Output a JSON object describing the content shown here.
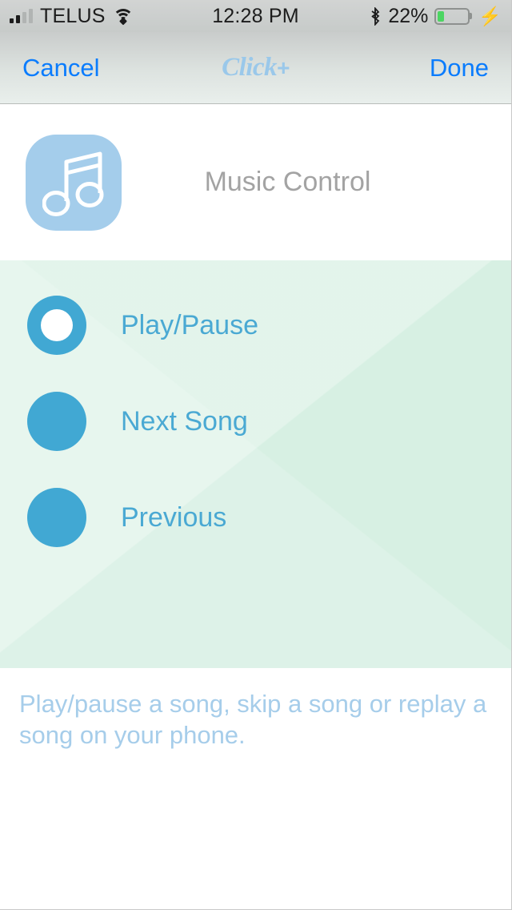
{
  "status_bar": {
    "carrier": "TELUS",
    "time": "12:28 PM",
    "battery_percent": "22%",
    "battery_level": 22,
    "signal_bars_filled": 2,
    "signal_bars_total": 4,
    "icons": {
      "signal": "signal-bars-icon",
      "wifi": "wifi-icon",
      "bluetooth": "bluetooth-icon",
      "battery": "battery-icon",
      "charging": "charging-bolt-icon"
    }
  },
  "nav_bar": {
    "cancel_label": "Cancel",
    "done_label": "Done",
    "brand": "Click",
    "brand_plus": "+"
  },
  "header": {
    "title": "Music Control",
    "icon_name": "music-note-icon"
  },
  "options": {
    "items": [
      {
        "label": "Play/Pause",
        "selected": true
      },
      {
        "label": "Next Song",
        "selected": false
      },
      {
        "label": "Previous",
        "selected": false
      }
    ]
  },
  "description": {
    "text": "Play/pause a song, skip a song or replay a song on your phone."
  },
  "colors": {
    "accent_blue": "#41a8d3",
    "link_blue": "#0a7cfd",
    "brand_light_blue": "#9ac8ea",
    "panel_green": "#d7f0e3",
    "title_gray": "#a3a3a3",
    "battery_green": "#4cd562"
  }
}
